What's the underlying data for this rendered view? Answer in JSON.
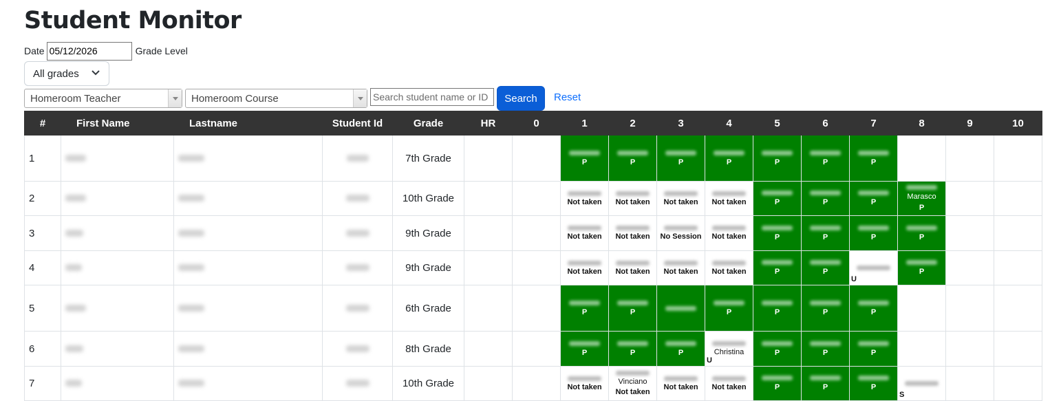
{
  "page_title": "Student Monitor",
  "filters": {
    "date_label": "Date",
    "date_value": "05/12/2026",
    "grade_level_label": "Grade Level",
    "grade_select_value": "All grades",
    "homeroom_teacher": "Homeroom Teacher",
    "homeroom_course": "Homeroom Course",
    "search_placeholder": "Search student name or ID",
    "search_button": "Search",
    "reset_link": "Reset"
  },
  "table": {
    "headers": [
      "#",
      "First Name",
      "Lastname",
      "Student Id",
      "Grade",
      "HR",
      "0",
      "1",
      "2",
      "3",
      "4",
      "5",
      "6",
      "7",
      "8",
      "9",
      "10"
    ],
    "rows": [
      {
        "num": "1",
        "grade": "7th Grade",
        "periods": [
          {
            "p": 1,
            "status": "P",
            "present": true
          },
          {
            "p": 2,
            "status": "P",
            "present": true
          },
          {
            "p": 3,
            "status": "P",
            "present": true
          },
          {
            "p": 4,
            "status": "P",
            "present": true
          },
          {
            "p": 5,
            "status": "P",
            "present": true
          },
          {
            "p": 6,
            "status": "P",
            "present": true
          },
          {
            "p": 7,
            "status": "P",
            "present": true
          }
        ]
      },
      {
        "num": "2",
        "grade": "10th Grade",
        "periods": [
          {
            "p": 1,
            "status": "Not taken",
            "present": false
          },
          {
            "p": 2,
            "status": "Not taken",
            "present": false
          },
          {
            "p": 3,
            "status": "Not taken",
            "present": false
          },
          {
            "p": 4,
            "status": "Not taken",
            "present": false
          },
          {
            "p": 5,
            "status": "P",
            "present": true
          },
          {
            "p": 6,
            "status": "P",
            "present": true
          },
          {
            "p": 7,
            "status": "P",
            "present": true
          },
          {
            "p": 8,
            "status": "P",
            "present": true,
            "visible_text": "Marasco"
          }
        ]
      },
      {
        "num": "3",
        "grade": "9th Grade",
        "periods": [
          {
            "p": 1,
            "status": "Not taken",
            "present": false
          },
          {
            "p": 2,
            "status": "Not taken",
            "present": false
          },
          {
            "p": 3,
            "status": "No Session",
            "present": false
          },
          {
            "p": 4,
            "status": "Not taken",
            "present": false
          },
          {
            "p": 5,
            "status": "P",
            "present": true
          },
          {
            "p": 6,
            "status": "P",
            "present": true
          },
          {
            "p": 7,
            "status": "P",
            "present": true
          },
          {
            "p": 8,
            "status": "P",
            "present": true
          }
        ]
      },
      {
        "num": "4",
        "grade": "9th Grade",
        "periods": [
          {
            "p": 1,
            "status": "Not taken",
            "present": false
          },
          {
            "p": 2,
            "status": "Not taken",
            "present": false
          },
          {
            "p": 3,
            "status": "Not taken",
            "present": false
          },
          {
            "p": 4,
            "status": "Not taken",
            "present": false
          },
          {
            "p": 5,
            "status": "P",
            "present": true
          },
          {
            "p": 6,
            "status": "P",
            "present": true
          },
          {
            "p": 7,
            "status": "U",
            "present": false
          },
          {
            "p": 8,
            "status": "P",
            "present": true
          }
        ]
      },
      {
        "num": "5",
        "grade": "6th Grade",
        "periods": [
          {
            "p": 1,
            "status": "P",
            "present": true
          },
          {
            "p": 2,
            "status": "P",
            "present": true
          },
          {
            "p": 3,
            "status": "",
            "present": true
          },
          {
            "p": 4,
            "status": "P",
            "present": true
          },
          {
            "p": 5,
            "status": "P",
            "present": true
          },
          {
            "p": 6,
            "status": "P",
            "present": true
          },
          {
            "p": 7,
            "status": "P",
            "present": true
          }
        ]
      },
      {
        "num": "6",
        "grade": "8th Grade",
        "periods": [
          {
            "p": 1,
            "status": "P",
            "present": true
          },
          {
            "p": 2,
            "status": "P",
            "present": true
          },
          {
            "p": 3,
            "status": "P",
            "present": true
          },
          {
            "p": 4,
            "status": "U",
            "present": false,
            "visible_text": "Christina"
          },
          {
            "p": 5,
            "status": "P",
            "present": true
          },
          {
            "p": 6,
            "status": "P",
            "present": true
          },
          {
            "p": 7,
            "status": "P",
            "present": true
          }
        ]
      },
      {
        "num": "7",
        "grade": "10th Grade",
        "periods": [
          {
            "p": 1,
            "status": "Not taken",
            "present": false
          },
          {
            "p": 2,
            "status": "Not taken",
            "present": false,
            "visible_text": "Vinciano"
          },
          {
            "p": 3,
            "status": "Not taken",
            "present": false
          },
          {
            "p": 4,
            "status": "Not taken",
            "present": false
          },
          {
            "p": 5,
            "status": "P",
            "present": true
          },
          {
            "p": 6,
            "status": "P",
            "present": true
          },
          {
            "p": 7,
            "status": "P",
            "present": true
          },
          {
            "p": 8,
            "status": "S",
            "present": false
          }
        ]
      }
    ]
  },
  "colors": {
    "present": "#008000",
    "header": "#343434",
    "primary": "#0b5ed7",
    "link": "#0d6efd"
  }
}
